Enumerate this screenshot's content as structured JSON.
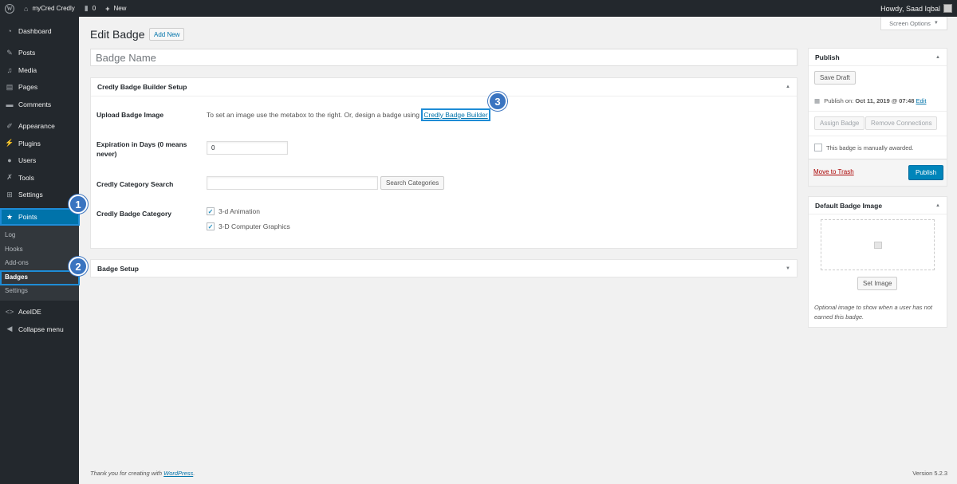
{
  "adminbar": {
    "site_name": "myCred Credly",
    "comments_count": "0",
    "new_label": "New",
    "howdy": "Howdy, Saad Iqbal"
  },
  "sidebar": {
    "items_top": [
      {
        "label": "Dashboard",
        "icon": "dashboard-icon"
      },
      {
        "label": "Posts",
        "icon": "pin-icon"
      },
      {
        "label": "Media",
        "icon": "media-icon"
      },
      {
        "label": "Pages",
        "icon": "pages-icon"
      },
      {
        "label": "Comments",
        "icon": "comments-icon"
      },
      {
        "label": "Appearance",
        "icon": "brush-icon"
      },
      {
        "label": "Plugins",
        "icon": "plugin-icon"
      },
      {
        "label": "Users",
        "icon": "users-icon"
      },
      {
        "label": "Tools",
        "icon": "wrench-icon"
      },
      {
        "label": "Settings",
        "icon": "settings-icon"
      }
    ],
    "points_label": "Points",
    "submenu": [
      "Log",
      "Hooks",
      "Add-ons",
      "Badges",
      "Settings"
    ],
    "acelde_label": "AceIDE",
    "collapse_label": "Collapse menu"
  },
  "header": {
    "title": "Edit Badge",
    "add_new": "Add New",
    "screen_options": "Screen Options"
  },
  "title_field": {
    "placeholder": "Badge Name"
  },
  "builder_box": {
    "title": "Credly Badge Builder Setup",
    "upload_label": "Upload Badge Image",
    "upload_text": "To set an image use the metabox to the right. Or, design a badge using",
    "builder_link": "Credly Badge Builder",
    "expiration_label": "Expiration in Days (0 means never)",
    "expiration_value": "0",
    "category_search_label": "Credly Category Search",
    "search_button": "Search Categories",
    "category_label": "Credly Badge Category",
    "categories": [
      "3-d Animation",
      "3-D Computer Graphics"
    ]
  },
  "badge_setup_box": {
    "title": "Badge Setup"
  },
  "publish_box": {
    "title": "Publish",
    "save_draft": "Save Draft",
    "publish_on_label": "Publish on:",
    "publish_on_date": "Oct 11, 2019 @ 07:48",
    "edit_link": "Edit",
    "assign_badge": "Assign Badge",
    "remove_connections": "Remove Connections",
    "manual_award": "This badge is manually awarded.",
    "move_to_trash": "Move to Trash",
    "publish_button": "Publish"
  },
  "image_box": {
    "title": "Default Badge Image",
    "set_image": "Set Image",
    "note": "Optional image to show when a user has not earned this badge."
  },
  "footer": {
    "thanks_prefix": "Thank you for creating with",
    "thanks_link": "WordPress",
    "thanks_suffix": ".",
    "version": "Version 5.2.3"
  },
  "annotations": [
    "1",
    "2",
    "3"
  ],
  "colors": {
    "admin_dark": "#23282d",
    "accent": "#0073aa",
    "highlight": "#1e8cd6",
    "step_badge": "#3a74c0"
  }
}
